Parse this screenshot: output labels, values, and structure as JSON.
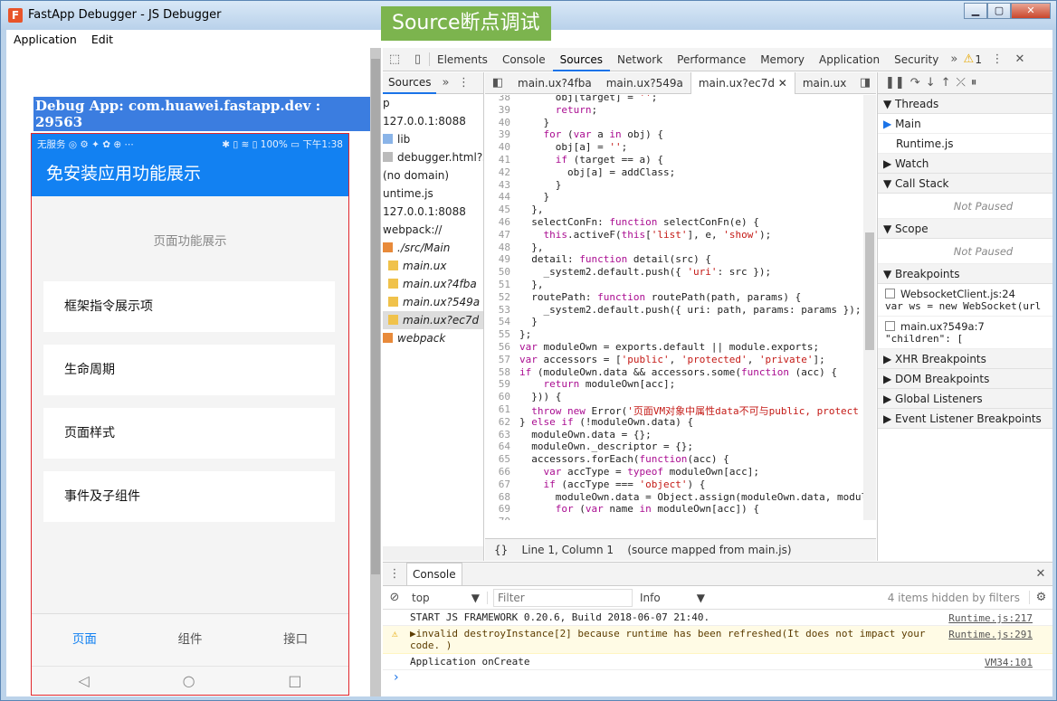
{
  "window": {
    "title": "FastApp Debugger - JS Debugger",
    "banner": "Source断点调试",
    "icon": "F"
  },
  "menu": [
    "Application",
    "Edit"
  ],
  "debug_line": "Debug App: com.huawei.fastapp.dev : 29563",
  "phone": {
    "status_left": "无服务 ◎ ⚙ ✦ ✿ ⊕ ⋯",
    "status_right": "✱ ▯ ≋ ▯ 100% ▭ 下午1:38",
    "app_title": "免安装应用功能展示",
    "page_title": "页面功能展示",
    "items": [
      "框架指令展示项",
      "生命周期",
      "页面样式",
      "事件及子组件"
    ],
    "tabs": [
      "页面",
      "组件",
      "接口"
    ],
    "nav": [
      "◁",
      "○",
      "□"
    ]
  },
  "devtools": {
    "tabs": [
      "Elements",
      "Console",
      "Sources",
      "Network",
      "Performance",
      "Memory",
      "Application",
      "Security"
    ],
    "active_tab": "Sources",
    "warning_count": "1",
    "navigator": {
      "tab": "Sources",
      "tree": [
        {
          "label": "p",
          "icon": "none",
          "indent": 0,
          "italic": false,
          "selected": false
        },
        {
          "label": "127.0.0.1:8088",
          "icon": "none",
          "indent": 0,
          "italic": false,
          "selected": false
        },
        {
          "label": "lib",
          "icon": "folder-blue",
          "indent": 0,
          "italic": false,
          "selected": false
        },
        {
          "label": "debugger.html?ses",
          "icon": "file",
          "indent": 0,
          "italic": false,
          "selected": false
        },
        {
          "label": "(no domain)",
          "icon": "none",
          "indent": 0,
          "italic": false,
          "selected": false
        },
        {
          "label": "untime.js",
          "icon": "none",
          "indent": 0,
          "italic": false,
          "selected": false
        },
        {
          "label": "127.0.0.1:8088",
          "icon": "none",
          "indent": 0,
          "italic": false,
          "selected": false
        },
        {
          "label": "webpack://",
          "icon": "none",
          "indent": 0,
          "italic": false,
          "selected": false
        },
        {
          "label": "./src/Main",
          "icon": "folder-orange",
          "indent": 0,
          "italic": true,
          "selected": false
        },
        {
          "label": "main.ux",
          "icon": "folder-yellow",
          "indent": 1,
          "italic": true,
          "selected": false
        },
        {
          "label": "main.ux?4fba",
          "icon": "folder-yellow",
          "indent": 1,
          "italic": true,
          "selected": false
        },
        {
          "label": "main.ux?549a",
          "icon": "folder-yellow",
          "indent": 1,
          "italic": true,
          "selected": false
        },
        {
          "label": "main.ux?ec7d",
          "icon": "folder-yellow",
          "indent": 1,
          "italic": true,
          "selected": true
        },
        {
          "label": "webpack",
          "icon": "folder-orange",
          "indent": 0,
          "italic": true,
          "selected": false
        }
      ]
    },
    "editor_tabs": [
      "main.ux?4fba",
      "main.ux?549a",
      "main.ux?ec7d",
      "main.ux"
    ],
    "active_editor_tab": "main.ux?ec7d",
    "code": [
      {
        "n": "38",
        "t": "      obj[target] = '';"
      },
      {
        "n": "39",
        "t": "      return;"
      },
      {
        "n": "40",
        "t": "    }"
      },
      {
        "n": "39",
        "t": "    for (var a in obj) {"
      },
      {
        "n": "40",
        "t": "      obj[a] = '';"
      },
      {
        "n": "41",
        "t": "      if (target == a) {"
      },
      {
        "n": "42",
        "t": "        obj[a] = addClass;"
      },
      {
        "n": "43",
        "t": "      }"
      },
      {
        "n": "44",
        "t": "    }"
      },
      {
        "n": "45",
        "t": "  },"
      },
      {
        "n": "46",
        "t": "  selectConFn: function selectConFn(e) {"
      },
      {
        "n": "47",
        "t": "    this.activeF(this['list'], e, 'show');"
      },
      {
        "n": "48",
        "t": "  },"
      },
      {
        "n": "49",
        "t": "  detail: function detail(src) {"
      },
      {
        "n": "50",
        "t": "    _system2.default.push({ 'uri': src });"
      },
      {
        "n": "51",
        "t": "  },"
      },
      {
        "n": "52",
        "t": "  routePath: function routePath(path, params) {"
      },
      {
        "n": "53",
        "t": "    _system2.default.push({ uri: path, params: params });"
      },
      {
        "n": "54",
        "t": "  }"
      },
      {
        "n": "55",
        "t": "};"
      },
      {
        "n": "56",
        "t": "var moduleOwn = exports.default || module.exports;"
      },
      {
        "n": "57",
        "t": "var accessors = ['public', 'protected', 'private'];"
      },
      {
        "n": "58",
        "t": "if (moduleOwn.data && accessors.some(function (acc) {"
      },
      {
        "n": "59",
        "t": "    return moduleOwn[acc];"
      },
      {
        "n": "60",
        "t": "  })) {"
      },
      {
        "n": "61",
        "t": "  throw new Error('页面VM对象中属性data不可与public, protect"
      },
      {
        "n": "62",
        "t": "} else if (!moduleOwn.data) {"
      },
      {
        "n": "63",
        "t": "  moduleOwn.data = {};"
      },
      {
        "n": "64",
        "t": "  moduleOwn._descriptor = {};"
      },
      {
        "n": "65",
        "t": "  accessors.forEach(function(acc) {"
      },
      {
        "n": "66",
        "t": "    var accType = typeof moduleOwn[acc];"
      },
      {
        "n": "67",
        "t": "    if (accType === 'object') {"
      },
      {
        "n": "68",
        "t": "      moduleOwn.data = Object.assign(moduleOwn.data, modul"
      },
      {
        "n": "69",
        "t": "      for (var name in moduleOwn[acc]) {"
      },
      {
        "n": "70",
        "t": ""
      }
    ],
    "status_line": {
      "braces": "{}",
      "position": "Line 1, Column 1",
      "mapped": "(source mapped from main.js)"
    },
    "debugger": {
      "threads": "Threads",
      "thread_items": [
        "Main",
        "Runtime.js"
      ],
      "watch": "Watch",
      "call_stack": "Call Stack",
      "not_paused": "Not Paused",
      "scope": "Scope",
      "breakpoints": "Breakpoints",
      "breakpoint_items": [
        {
          "file": "WebsocketClient.js:24",
          "code": "var ws = new WebSocket(url"
        },
        {
          "file": "main.ux?549a:7",
          "code": "\"children\": ["
        }
      ],
      "more_sections": [
        "XHR Breakpoints",
        "DOM Breakpoints",
        "Global Listeners",
        "Event Listener Breakpoints"
      ]
    },
    "console": {
      "tab": "Console",
      "context": "top",
      "filter_placeholder": "Filter",
      "level": "Info",
      "hidden": "4 items hidden by filters",
      "messages": [
        {
          "text": "START JS FRAMEWORK 0.20.6, Build 2018-06-07 21:40.",
          "src": "Runtime.js:217",
          "type": "log"
        },
        {
          "text": "▶invalid destroyInstance[2] because runtime has been refreshed(It does not impact your code. )",
          "src": "Runtime.js:291",
          "type": "warn"
        },
        {
          "text": "Application onCreate",
          "src": "VM34:101",
          "type": "log"
        }
      ],
      "prompt": "›"
    }
  }
}
